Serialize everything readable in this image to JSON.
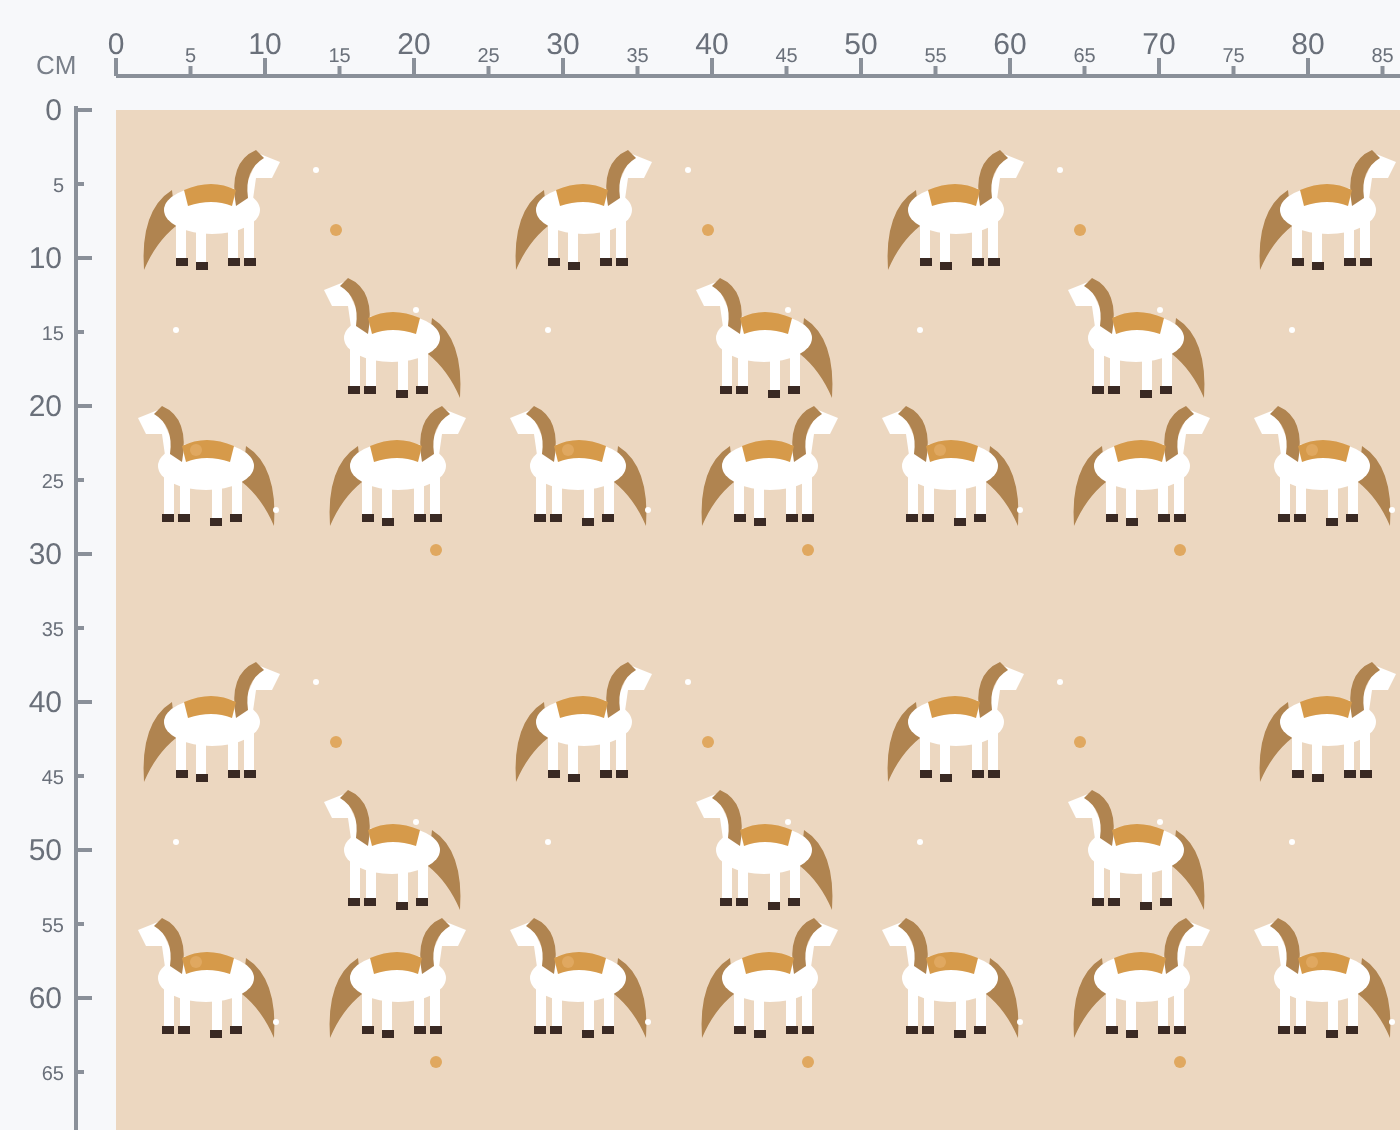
{
  "ruler_top": {
    "unit": "CM",
    "labels": [
      "0",
      "5",
      "10",
      "15",
      "20",
      "25",
      "30",
      "35",
      "40",
      "45",
      "50",
      "55",
      "60",
      "65",
      "70",
      "75",
      "80",
      "85"
    ]
  },
  "ruler_left": {
    "labels": [
      "0",
      "5",
      "10",
      "15",
      "20",
      "25",
      "30",
      "35",
      "40",
      "45",
      "50",
      "55",
      "60",
      "65"
    ]
  }
}
